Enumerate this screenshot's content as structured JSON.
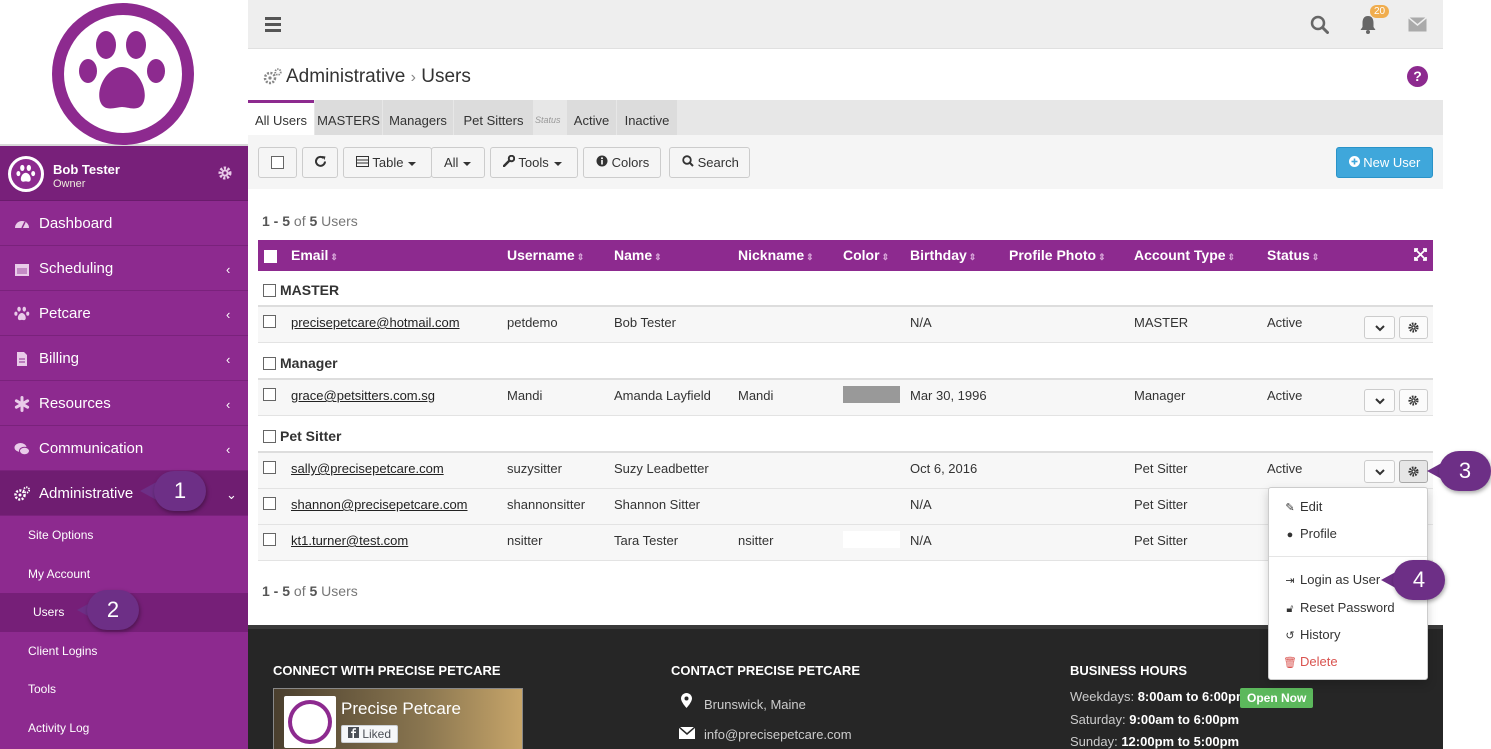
{
  "brand": {
    "primary": "#8d2a8f",
    "accent": "#3fa7db"
  },
  "user": {
    "name": "Bob Tester",
    "role": "Owner"
  },
  "nav": [
    {
      "label": "Dashboard",
      "icon": "dashboard-icon"
    },
    {
      "label": "Scheduling",
      "icon": "calendar-icon"
    },
    {
      "label": "Petcare",
      "icon": "paw-icon"
    },
    {
      "label": "Billing",
      "icon": "document-icon"
    },
    {
      "label": "Resources",
      "icon": "asterisk-icon"
    },
    {
      "label": "Communication",
      "icon": "comments-icon"
    },
    {
      "label": "Administrative",
      "icon": "gears-icon"
    }
  ],
  "subnav": [
    "Site Options",
    "My Account",
    "Users",
    "Client Logins",
    "Tools",
    "Activity Log"
  ],
  "topbar": {
    "notification_count": "20"
  },
  "page": {
    "section": "Administrative",
    "separator": "›",
    "title": "Users",
    "help": "?"
  },
  "tabs": {
    "all": "All Users",
    "masters": "MASTERS",
    "managers": "Managers",
    "sitters": "Pet Sitters",
    "status": "Status",
    "active": "Active",
    "inactive": "Inactive"
  },
  "toolbar": {
    "table": "Table",
    "all": "All",
    "tools": "Tools",
    "colors": "Colors",
    "search": "Search",
    "new_user": "New User"
  },
  "count": {
    "range": "1 - 5",
    "of": "of",
    "total": "5",
    "unit": "Users"
  },
  "columns": [
    "Email",
    "Username",
    "Name",
    "Nickname",
    "Color",
    "Birthday",
    "Profile Photo",
    "Account Type",
    "Status"
  ],
  "groups": [
    "MASTER",
    "Manager",
    "Pet Sitter"
  ],
  "rows": [
    {
      "email": "precisepetcare@hotmail.com",
      "username": "petdemo",
      "name": "Bob Tester",
      "nickname": "",
      "color": "",
      "birthday": "N/A",
      "type": "MASTER",
      "status": "Active"
    },
    {
      "email": "grace@petsitters.com.sg",
      "username": "Mandi",
      "name": "Amanda Layfield",
      "nickname": "Mandi",
      "color": "#999999",
      "birthday": "Mar 30, 1996",
      "type": "Manager",
      "status": "Active"
    },
    {
      "email": "sally@precisepetcare.com",
      "username": "suzysitter",
      "name": "Suzy Leadbetter",
      "nickname": "",
      "color": "",
      "birthday": "Oct 6, 2016",
      "type": "Pet Sitter",
      "status": "Active"
    },
    {
      "email": "shannon@precisepetcare.com",
      "username": "shannonsitter",
      "name": "Shannon Sitter",
      "nickname": "",
      "color": "",
      "birthday": "N/A",
      "type": "Pet Sitter",
      "status": ""
    },
    {
      "email": "kt1.turner@test.com",
      "username": "nsitter",
      "name": "Tara Tester",
      "nickname": "nsitter",
      "color": "#ffffff",
      "birthday": "N/A",
      "type": "Pet Sitter",
      "status": ""
    }
  ],
  "dropdown": {
    "edit": "Edit",
    "profile": "Profile",
    "login_as": "Login as User",
    "reset": "Reset Password",
    "history": "History",
    "delete": "Delete"
  },
  "callouts": [
    "1",
    "2",
    "3",
    "4"
  ],
  "footer": {
    "connect_title": "CONNECT WITH PRECISE PETCARE",
    "fb_name": "Precise Petcare",
    "fb_liked": "Liked",
    "contact_title": "CONTACT PRECISE PETCARE",
    "location": "Brunswick, Maine",
    "email": "info@precisepetcare.com",
    "hours_title": "BUSINESS HOURS",
    "weekdays_label": "Weekdays:",
    "weekdays": "8:00am to 6:00pm",
    "open_now": "Open Now",
    "saturday_label": "Saturday:",
    "saturday": "9:00am to 6:00pm",
    "sunday_label": "Sunday:",
    "sunday": "12:00pm to 5:00pm"
  }
}
